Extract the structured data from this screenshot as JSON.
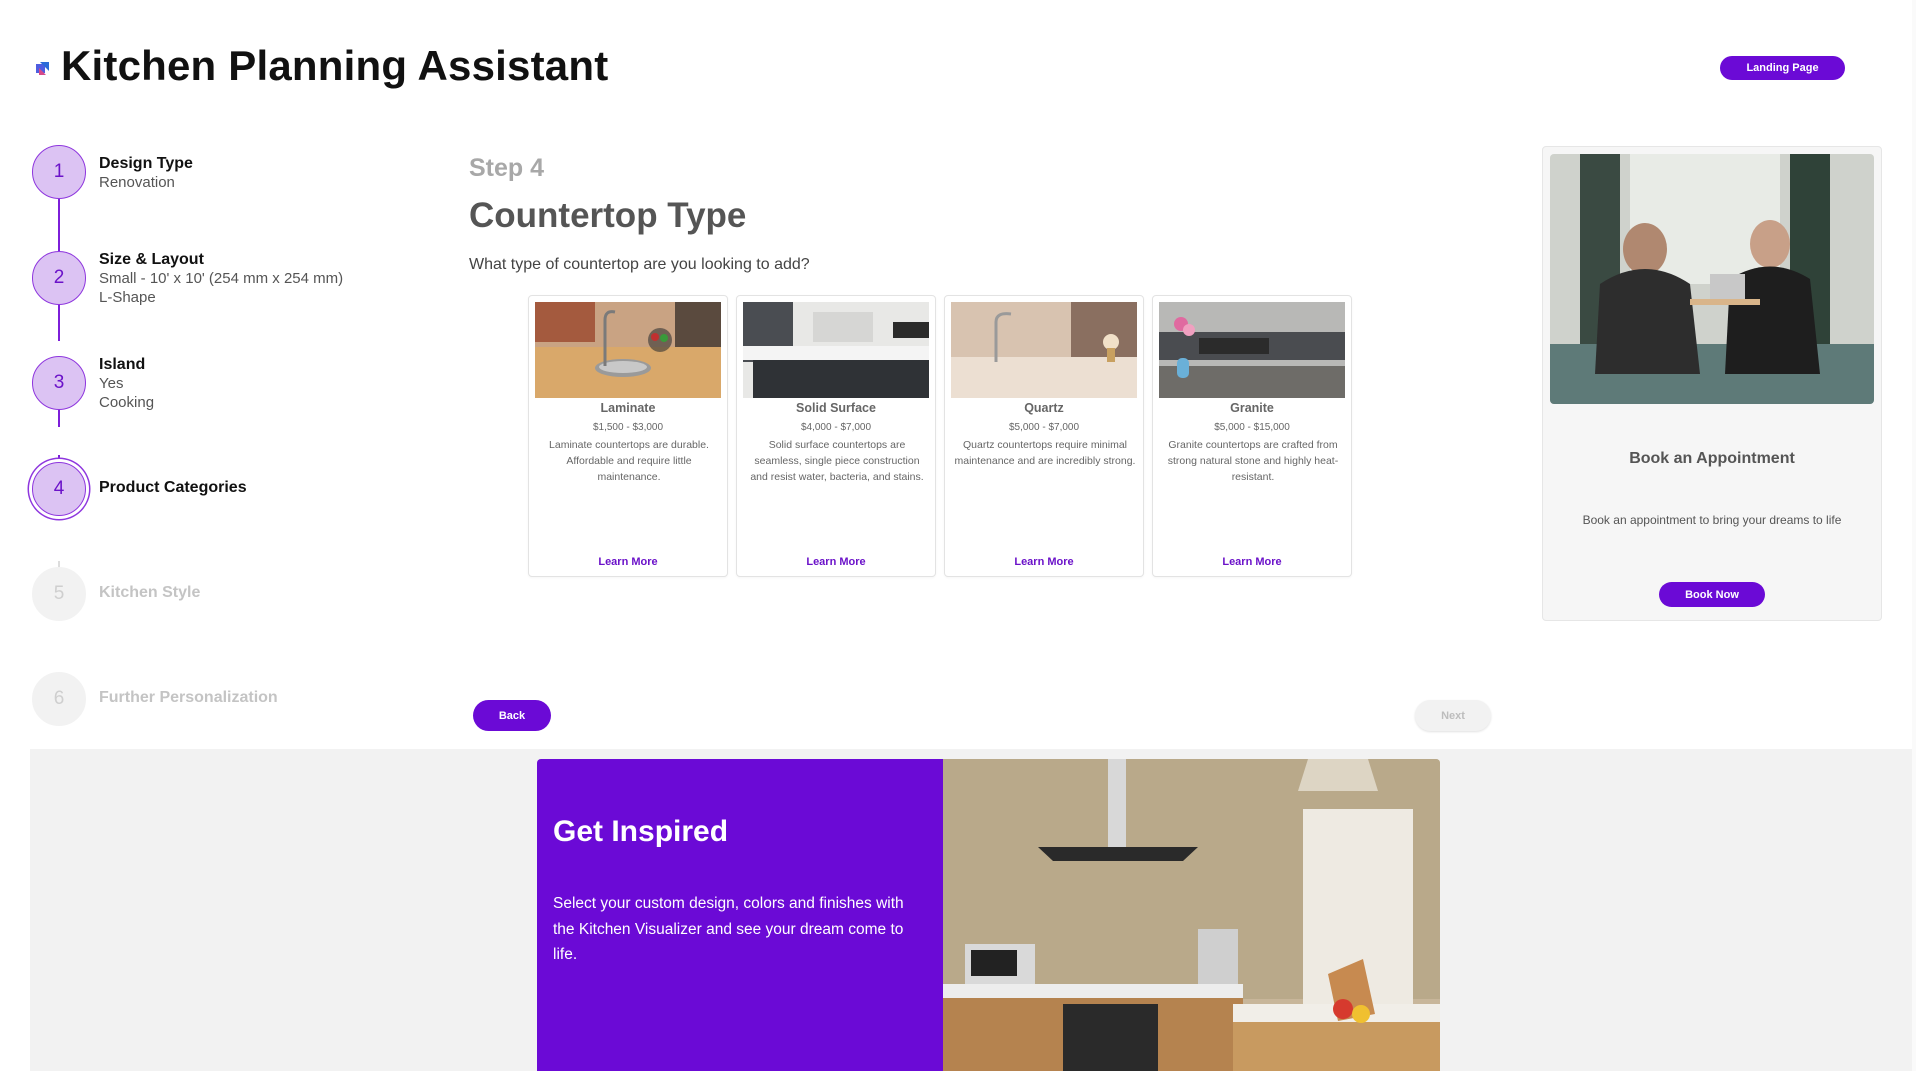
{
  "header": {
    "logo_icon": "app-logo-icon",
    "title": "Kitchen Planning Assistant",
    "landing_page_label": "Landing Page"
  },
  "stepper": {
    "steps": [
      {
        "number": "1",
        "label": "Design Type",
        "details": [
          "Renovation"
        ],
        "state": "completed"
      },
      {
        "number": "2",
        "label": "Size & Layout",
        "details": [
          "Small - 10' x 10' (254 mm x 254 mm)",
          "L-Shape"
        ],
        "state": "completed"
      },
      {
        "number": "3",
        "label": "Island",
        "details": [
          "Yes",
          "Cooking"
        ],
        "state": "completed"
      },
      {
        "number": "4",
        "label": "Product Categories",
        "details": [],
        "state": "current"
      },
      {
        "number": "5",
        "label": "Kitchen Style",
        "details": [],
        "state": "disabled"
      },
      {
        "number": "6",
        "label": "Further Personalization",
        "details": [],
        "state": "disabled"
      }
    ]
  },
  "main": {
    "step_number": "Step 4",
    "title": "Countertop Type",
    "question": "What type of countertop are you looking to add?",
    "options": [
      {
        "name": "Laminate",
        "price": "$1,500 - $3,000",
        "description": "Laminate countertops are durable. Affordable and require little maintenance.",
        "link": "Learn More"
      },
      {
        "name": "Solid Surface",
        "price": "$4,000 - $7,000",
        "description": "Solid surface countertops are seamless, single piece construction and resist water, bacteria, and stains.",
        "link": "Learn More"
      },
      {
        "name": "Quartz",
        "price": "$5,000 - $7,000",
        "description": "Quartz countertops require minimal maintenance and are incredibly strong.",
        "link": "Learn More"
      },
      {
        "name": "Granite",
        "price": "$5,000 - $15,000",
        "description": "Granite countertops are crafted from strong natural stone and highly heat-resistant.",
        "link": "Learn More"
      }
    ],
    "back_label": "Back",
    "next_label": "Next"
  },
  "appointment": {
    "title": "Book an Appointment",
    "description": "Book an appointment to bring your dreams to life",
    "button_label": "Book Now"
  },
  "inspiration": {
    "title": "Get Inspired",
    "text": "Select your custom design, colors and finishes with the Kitchen Visualizer and see your dream come to life."
  },
  "colors": {
    "accent": "#6b0ad6",
    "step_circle_fill": "#dcc3f3",
    "step_line": "#7d1fd9"
  }
}
